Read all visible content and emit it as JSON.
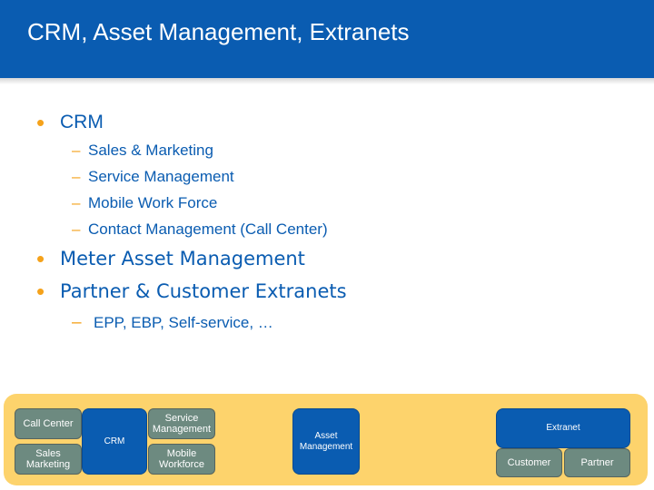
{
  "slide": {
    "title": "CRM, Asset Management, Extranets",
    "bullets": [
      {
        "label": "CRM",
        "sub": [
          "Sales & Marketing",
          "Service Management",
          "Mobile Work Force",
          "Contact Management (Call Center)"
        ]
      },
      {
        "label": "Meter Asset Management"
      },
      {
        "label": "Partner & Customer Extranets",
        "sub": [
          "EPP, EBP, Self-service, …"
        ]
      }
    ]
  },
  "diagram": {
    "call_center": "Call Center",
    "sales_marketing": "Sales\nMarketing",
    "crm": "CRM",
    "service_management": "Service\nManagement",
    "mobile_workforce": "Mobile\nWorkforce",
    "asset_management": "Asset\nManagement",
    "extranet": "Extranet",
    "customer": "Customer",
    "partner": "Partner"
  },
  "colors": {
    "title_bar": "#0a5cb1",
    "text_blue": "#0a5cb1",
    "bullet_orange": "#f5a21b",
    "diagram_background": "#fdd36c",
    "box_gray": "#6d8a80"
  }
}
